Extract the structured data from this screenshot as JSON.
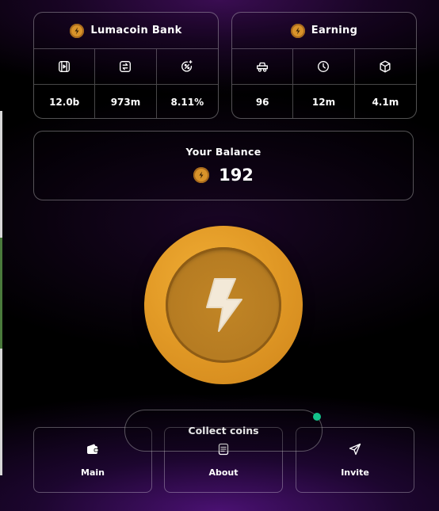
{
  "bank": {
    "title": "Lumacoin Bank",
    "icons": [
      "play-box-icon",
      "exchange-box-icon",
      "percent-sparkle-icon"
    ],
    "values": [
      "12.0b",
      "973m",
      "8.11%"
    ]
  },
  "earning": {
    "title": "Earning",
    "icons": [
      "wagon-icon",
      "clock-icon",
      "cube-icon"
    ],
    "values": [
      "96",
      "12m",
      "4.1m"
    ]
  },
  "balance": {
    "title": "Your Balance",
    "value": "192"
  },
  "coin": {
    "icon": "lightning-bolt-icon",
    "color": "#e29a26"
  },
  "collect": {
    "label": "Collect coins",
    "status_dot_color": "#13c28a"
  },
  "nav": [
    {
      "label": "Main",
      "icon": "wallet-icon"
    },
    {
      "label": "About",
      "icon": "document-icon"
    },
    {
      "label": "Invite",
      "icon": "paper-plane-icon"
    }
  ]
}
